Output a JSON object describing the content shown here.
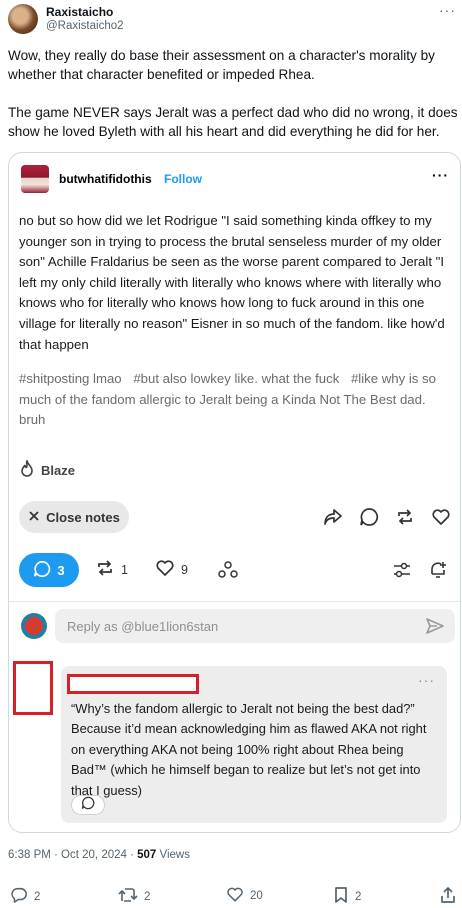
{
  "tweet": {
    "author_name": "Raxistaicho",
    "author_handle": "@Raxistaicho2",
    "more_icon": "more-horizontal-icon",
    "body": [
      "Wow, they really do base their assessment on a character's morality by whether that character benefited or impeded Rhea.",
      "The game NEVER says Jeralt was a perfect dad who did no wrong, it does show he loved Byleth with all his heart and did everything he did for her."
    ],
    "meta": {
      "time_date": "6:38 PM · Oct 20, 2024 · ",
      "views_count": "507",
      "views_label": " Views"
    },
    "actions": {
      "replies": "2",
      "retweets": "2",
      "likes": "20",
      "bookmarks": "2"
    }
  },
  "tumblr": {
    "username": "butwhatifidothis",
    "follow_label": "Follow",
    "post_text": "no but so how did we let Rodrigue \"I said something kinda offkey to my younger son in trying to process the brutal senseless murder of my older son\" Achille Fraldarius be seen as the worse parent compared to Jeralt \"I left my only child literally with literally who knows where with literally who knows who for literally who knows how long to fuck around in this one village for literally no reason\" Eisner in so much of the fandom. like how'd that happen",
    "tags": [
      "#shitposting lmao",
      "#but also lowkey like. what the fuck",
      "#like why is so much of the fandom allergic to Jeralt being a Kinda Not The Best dad. bruh"
    ],
    "blaze_label": "Blaze",
    "close_notes_label": "Close notes",
    "notes_count": "3",
    "reblogs_count": "1",
    "likes_count": "9",
    "reply_placeholder": "Reply as @blue1lion6stan",
    "comment_text": "“Why’s the fandom allergic to Jeralt not being the best dad?” Because it’d mean acknowledging him as flawed AKA not right on everything AKA not being 100% right about Rhea being Bad™ (which he himself began to realize but let’s not get into that I guess)",
    "colors": {
      "accent": "#1d9bf0",
      "redaction": "#d61f26"
    }
  }
}
